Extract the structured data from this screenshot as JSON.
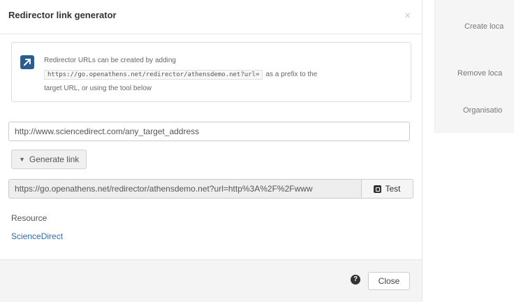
{
  "side_panel": {
    "items": [
      "Create loca",
      "Remove loca",
      "Organisatio"
    ]
  },
  "modal": {
    "title": "Redirector link generator",
    "close_x": "×",
    "info": {
      "icon": "external-link-icon",
      "line1": "Redirector URLs can be created by adding",
      "code": "https://go.openathens.net/redirector/athensdemo.net?url=",
      "line2_suffix": "as a prefix to the",
      "line3": "target URL, or using the tool below"
    },
    "target_url_value": "http://www.sciencedirect.com/any_target_address",
    "generate_label": "Generate link",
    "generated_url_value": "https://go.openathens.net/redirector/athensdemo.net?url=http%3A%2F%2Fwww",
    "test_label": "Test",
    "resource_label": "Resource",
    "resource_link": "ScienceDirect",
    "help_glyph": "?",
    "close_label": "Close"
  },
  "colors": {
    "accent": "#2a5d90",
    "link": "#2a6db5"
  }
}
